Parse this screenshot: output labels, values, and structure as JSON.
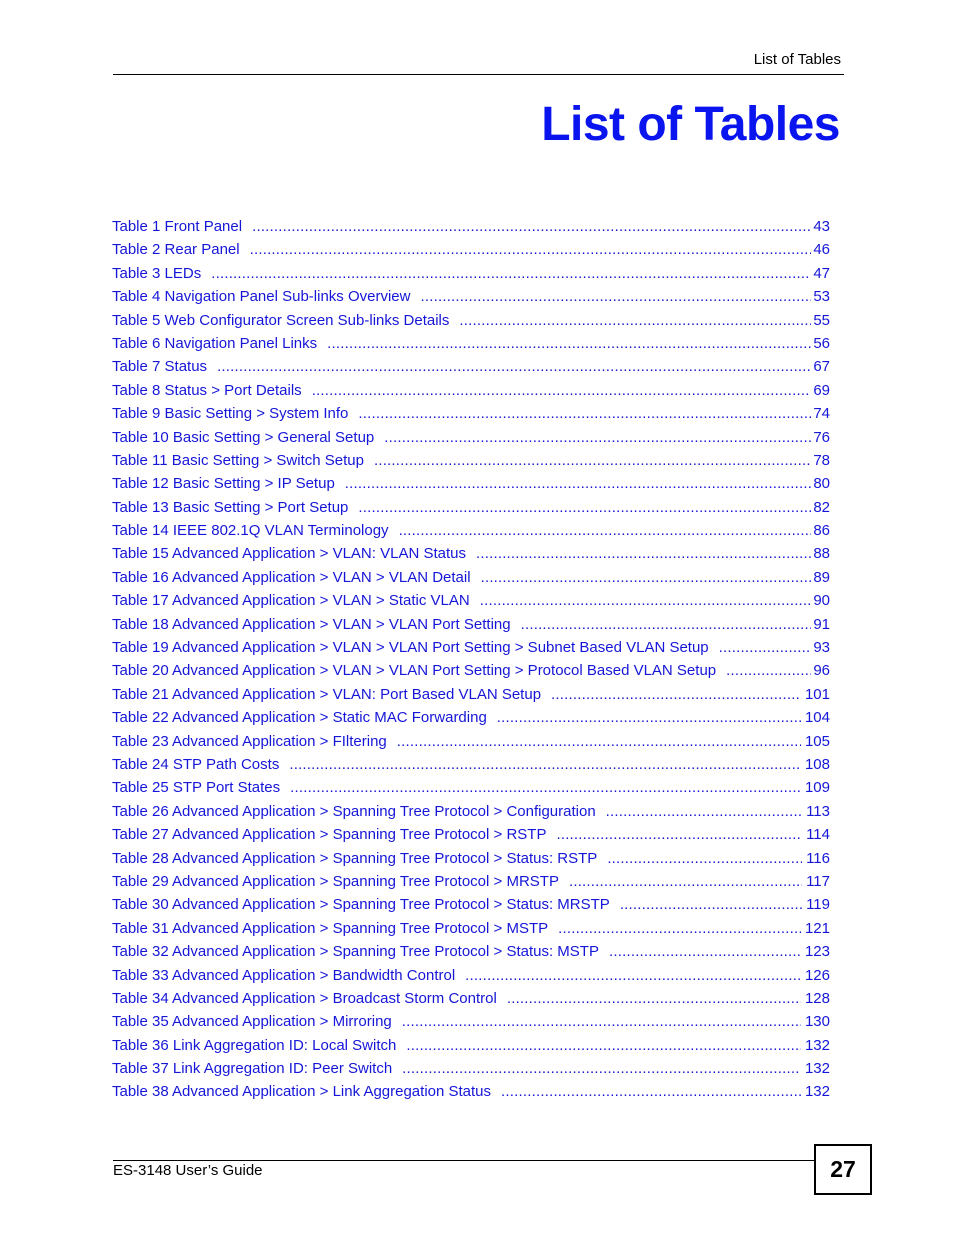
{
  "header": {
    "running_title": "List of Tables"
  },
  "page_title": "List of Tables",
  "toc": {
    "entries": [
      {
        "title": "Table 1 Front Panel",
        "page": "43"
      },
      {
        "title": "Table 2 Rear Panel",
        "page": "46"
      },
      {
        "title": "Table 3 LEDs",
        "page": "47"
      },
      {
        "title": "Table 4 Navigation Panel Sub-links Overview",
        "page": "53"
      },
      {
        "title": "Table 5 Web Configurator Screen Sub-links Details",
        "page": "55"
      },
      {
        "title": "Table 6 Navigation Panel Links",
        "page": "56"
      },
      {
        "title": "Table 7 Status",
        "page": "67"
      },
      {
        "title": "Table 8 Status > Port Details",
        "page": "69"
      },
      {
        "title": "Table 9 Basic Setting > System Info",
        "page": "74"
      },
      {
        "title": "Table 10 Basic Setting > General Setup",
        "page": "76"
      },
      {
        "title": "Table 11 Basic Setting > Switch Setup",
        "page": "78"
      },
      {
        "title": "Table 12 Basic Setting > IP Setup",
        "page": "80"
      },
      {
        "title": "Table 13 Basic Setting > Port Setup",
        "page": "82"
      },
      {
        "title": "Table 14 IEEE 802.1Q VLAN Terminology",
        "page": "86"
      },
      {
        "title": "Table 15 Advanced Application > VLAN: VLAN Status",
        "page": "88"
      },
      {
        "title": "Table 16 Advanced Application > VLAN > VLAN Detail",
        "page": "89"
      },
      {
        "title": "Table 17 Advanced Application > VLAN > Static VLAN",
        "page": "90"
      },
      {
        "title": "Table 18 Advanced Application > VLAN > VLAN Port Setting",
        "page": "91"
      },
      {
        "title": "Table 19 Advanced Application > VLAN > VLAN Port Setting > Subnet Based VLAN Setup",
        "page": "93"
      },
      {
        "title": "Table 20 Advanced Application > VLAN > VLAN Port Setting > Protocol Based VLAN Setup",
        "page": "96"
      },
      {
        "title": "Table 21 Advanced Application > VLAN: Port Based VLAN Setup",
        "page": "101"
      },
      {
        "title": "Table 22 Advanced Application > Static MAC Forwarding",
        "page": "104"
      },
      {
        "title": "Table 23 Advanced Application > FIltering",
        "page": "105"
      },
      {
        "title": "Table 24 STP Path Costs",
        "page": "108"
      },
      {
        "title": "Table 25 STP Port States",
        "page": "109"
      },
      {
        "title": "Table 26 Advanced Application > Spanning Tree Protocol > Configuration",
        "page": "113"
      },
      {
        "title": "Table 27 Advanced Application > Spanning Tree Protocol > RSTP",
        "page": "114"
      },
      {
        "title": "Table 28 Advanced Application > Spanning Tree Protocol > Status: RSTP",
        "page": "116"
      },
      {
        "title": "Table 29 Advanced Application > Spanning Tree Protocol > MRSTP",
        "page": "117"
      },
      {
        "title": "Table 30 Advanced Application > Spanning Tree Protocol > Status: MRSTP",
        "page": "119"
      },
      {
        "title": "Table 31 Advanced Application > Spanning Tree Protocol > MSTP",
        "page": "121"
      },
      {
        "title": "Table 32 Advanced Application > Spanning Tree Protocol > Status: MSTP",
        "page": "123"
      },
      {
        "title": "Table 33 Advanced Application > Bandwidth Control",
        "page": "126"
      },
      {
        "title": "Table 34 Advanced Application > Broadcast Storm Control",
        "page": "128"
      },
      {
        "title": "Table 35 Advanced Application > Mirroring",
        "page": "130"
      },
      {
        "title": "Table 36 Link Aggregation ID: Local Switch",
        "page": "132"
      },
      {
        "title": "Table 37 Link Aggregation ID: Peer Switch",
        "page": "132"
      },
      {
        "title": "Table 38 Advanced Application > Link Aggregation Status",
        "page": "132"
      }
    ]
  },
  "footer": {
    "guide_title": "ES-3148 User’s Guide",
    "page_number": "27"
  },
  "colors": {
    "title_blue": "#0a14ee",
    "link_blue": "#1616d8",
    "text_black": "#000000"
  }
}
